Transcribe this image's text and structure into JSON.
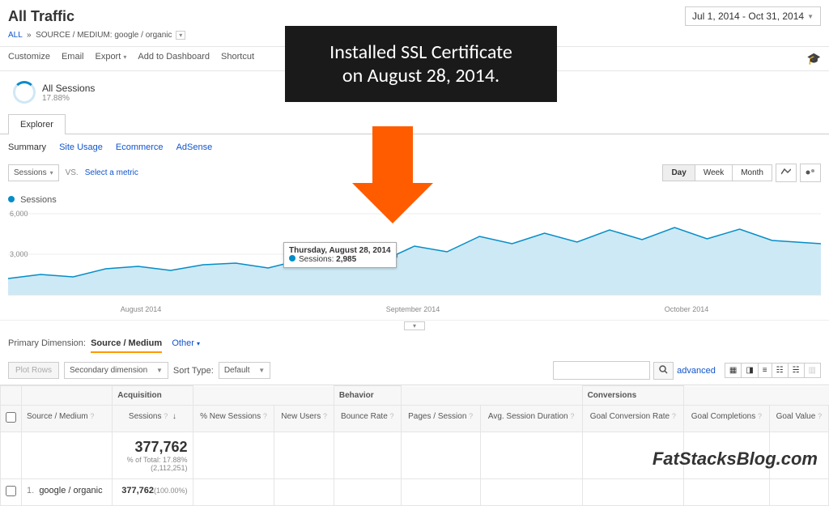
{
  "page_title": "All Traffic",
  "date_range": "Jul 1, 2014 - Oct 31, 2014",
  "breadcrumb": {
    "all": "ALL",
    "label": "SOURCE / MEDIUM:",
    "value": "google / organic"
  },
  "toolbar": {
    "customize": "Customize",
    "email": "Email",
    "export": "Export",
    "add_dash": "Add to Dashboard",
    "shortcut": "Shortcut"
  },
  "sessions_block": {
    "title": "All Sessions",
    "pct": "17.88%"
  },
  "explorer_tab": "Explorer",
  "sub_nav": {
    "summary": "Summary",
    "site_usage": "Site Usage",
    "ecommerce": "Ecommerce",
    "adsense": "AdSense"
  },
  "metrics": {
    "sessions_dd": "Sessions",
    "vs": "VS.",
    "select": "Select a metric"
  },
  "time_btns": {
    "day": "Day",
    "week": "Week",
    "month": "Month"
  },
  "legend": "Sessions",
  "y_ticks": {
    "top": "6,000",
    "mid": "3,000"
  },
  "x_ticks": {
    "a": "August 2014",
    "b": "September 2014",
    "c": "October 2014"
  },
  "tooltip": {
    "date": "Thursday, August 28, 2014",
    "metric": "Sessions:",
    "value": "2,985"
  },
  "primary_dim": {
    "label": "Primary Dimension:",
    "active": "Source / Medium",
    "other": "Other"
  },
  "filter_row": {
    "plot": "Plot Rows",
    "sec_dim": "Secondary dimension",
    "sort": "Sort Type:",
    "default": "Default",
    "advanced": "advanced"
  },
  "table": {
    "source_medium": "Source / Medium",
    "groups": {
      "acq": "Acquisition",
      "beh": "Behavior",
      "conv": "Conversions"
    },
    "cols": {
      "sessions": "Sessions",
      "new_sess": "% New Sessions",
      "new_users": "New Users",
      "bounce": "Bounce Rate",
      "pages": "Pages / Session",
      "avg_dur": "Avg. Session Duration",
      "gcr": "Goal Conversion Rate",
      "gcomp": "Goal Completions",
      "gval": "Goal Value"
    },
    "total": {
      "value": "377,762",
      "pct_label": "% of Total: 17.88%",
      "pct_abs": "(2,112,251)"
    },
    "row1": {
      "idx": "1.",
      "name": "google / organic",
      "sessions": "377,762",
      "pct": "(100.00%)"
    }
  },
  "overlay": {
    "l1": "Installed SSL Certificate",
    "l2": "on August 28, 2014."
  },
  "brand": "FatStacksBlog.com",
  "chart_data": {
    "type": "line",
    "title": "Sessions",
    "ylim": [
      0,
      6000
    ],
    "x_range": [
      "2014-07-01",
      "2014-10-31"
    ],
    "annotation": {
      "date": "2014-08-28",
      "value": 2985,
      "label": "Installed SSL Certificate"
    },
    "series": [
      {
        "name": "Sessions",
        "x": [
          "2014-07-01",
          "2014-07-05",
          "2014-07-10",
          "2014-07-15",
          "2014-07-20",
          "2014-07-25",
          "2014-07-30",
          "2014-08-04",
          "2014-08-09",
          "2014-08-14",
          "2014-08-19",
          "2014-08-24",
          "2014-08-28",
          "2014-09-02",
          "2014-09-07",
          "2014-09-12",
          "2014-09-17",
          "2014-09-22",
          "2014-09-27",
          "2014-10-02",
          "2014-10-07",
          "2014-10-12",
          "2014-10-17",
          "2014-10-22",
          "2014-10-27",
          "2014-10-31"
        ],
        "values": [
          1300,
          1600,
          1400,
          1900,
          2100,
          1800,
          2200,
          2300,
          2000,
          2600,
          2400,
          2850,
          2985,
          3600,
          3200,
          4500,
          3800,
          4700,
          4100,
          5000,
          4300,
          5200,
          4400,
          5100,
          4200,
          3900
        ]
      }
    ]
  }
}
